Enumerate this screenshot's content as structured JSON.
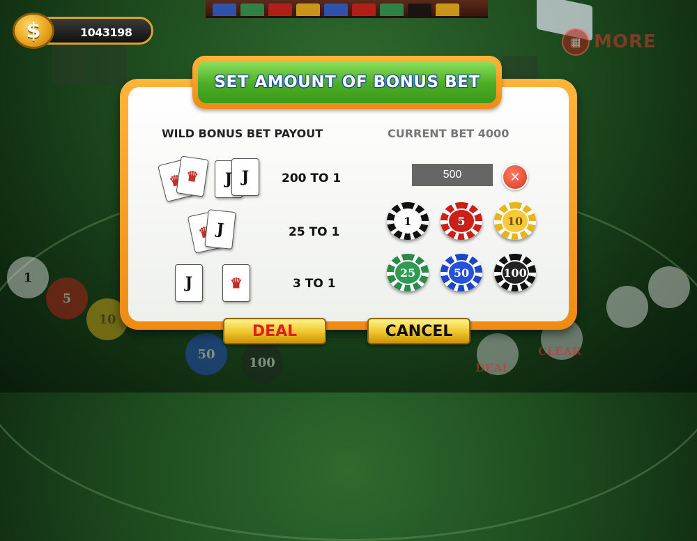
{
  "hud": {
    "coin_symbol": "$",
    "balance": "1043198",
    "more_label": "MORE"
  },
  "dialog": {
    "title": "SET AMOUNT OF BONUS BET",
    "payout_title": "WILD BONUS BET PAYOUT",
    "current_bet": "CURRENT BET 4000",
    "payouts": [
      {
        "label": "200 TO 1"
      },
      {
        "label": "25 TO 1"
      },
      {
        "label": "3 TO 1"
      }
    ],
    "bet_input_value": "500",
    "clear_symbol": "✕",
    "chips": [
      {
        "value": "1",
        "color": "#111111",
        "edge": "#f5f5f5",
        "face": "#ffffff",
        "text": "#111111"
      },
      {
        "value": "5",
        "color": "#c9201a",
        "edge": "#ffffff",
        "face": "#c9201a",
        "text": "#ffffff"
      },
      {
        "value": "10",
        "color": "#e8b41a",
        "edge": "#ffffff",
        "face": "#f5c93a",
        "text": "#7a5a00"
      },
      {
        "value": "25",
        "color": "#2a8a4a",
        "edge": "#ffffff",
        "face": "#2f9a52",
        "text": "#ffffff"
      },
      {
        "value": "50",
        "color": "#1e46c8",
        "edge": "#ffffff",
        "face": "#2552d8",
        "text": "#ffffff"
      },
      {
        "value": "100",
        "color": "#111111",
        "edge": "#ffffff",
        "face": "#222222",
        "text": "#ffffff"
      }
    ],
    "deal_label": "DEAL",
    "cancel_label": "CANCEL"
  },
  "background": {
    "chip_labels": [
      "1",
      "5",
      "10",
      "50",
      "100"
    ],
    "deal_label": "DEAL",
    "clear_label": "CLEAR"
  }
}
